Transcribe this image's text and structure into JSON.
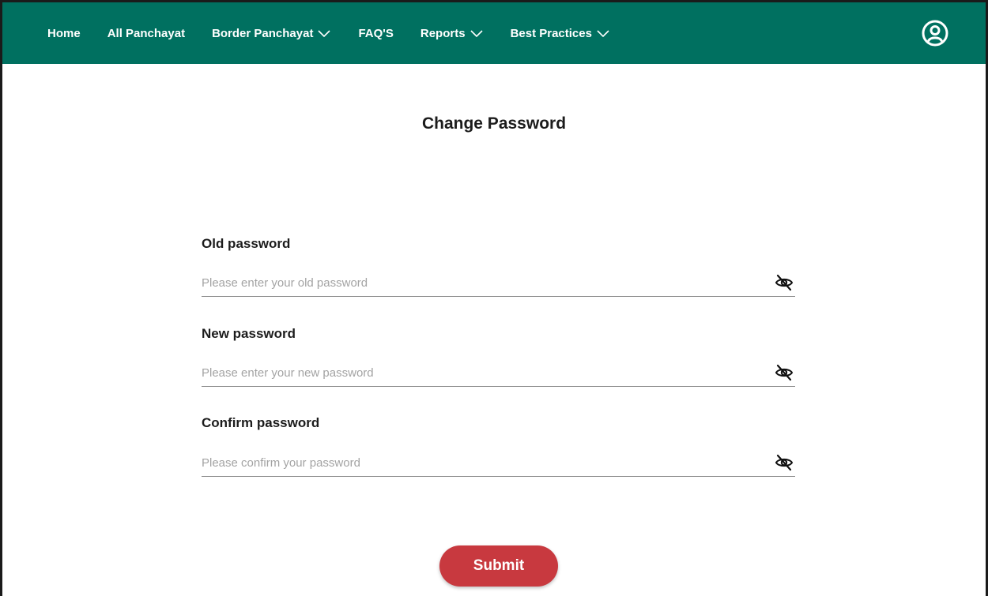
{
  "nav": {
    "items": [
      {
        "label": "Home",
        "dropdown": false
      },
      {
        "label": "All Panchayat",
        "dropdown": false
      },
      {
        "label": "Border Panchayat",
        "dropdown": true
      },
      {
        "label": "FAQ'S",
        "dropdown": false
      },
      {
        "label": "Reports",
        "dropdown": true
      },
      {
        "label": "Best Practices",
        "dropdown": true
      }
    ],
    "user_icon": "user-circle-icon",
    "background": "#007060"
  },
  "page": {
    "title": "Change Password"
  },
  "form": {
    "old_password": {
      "label": "Old password",
      "placeholder": "Please enter your old password",
      "value": "",
      "toggle_icon": "eye-slash-icon"
    },
    "new_password": {
      "label": "New password",
      "placeholder": "Please enter your new password",
      "value": "",
      "toggle_icon": "eye-slash-icon"
    },
    "confirm_password": {
      "label": "Confirm password",
      "placeholder": "Please confirm your password",
      "value": "",
      "toggle_icon": "eye-slash-icon"
    },
    "submit_label": "Submit",
    "submit_color": "#c8393f"
  }
}
